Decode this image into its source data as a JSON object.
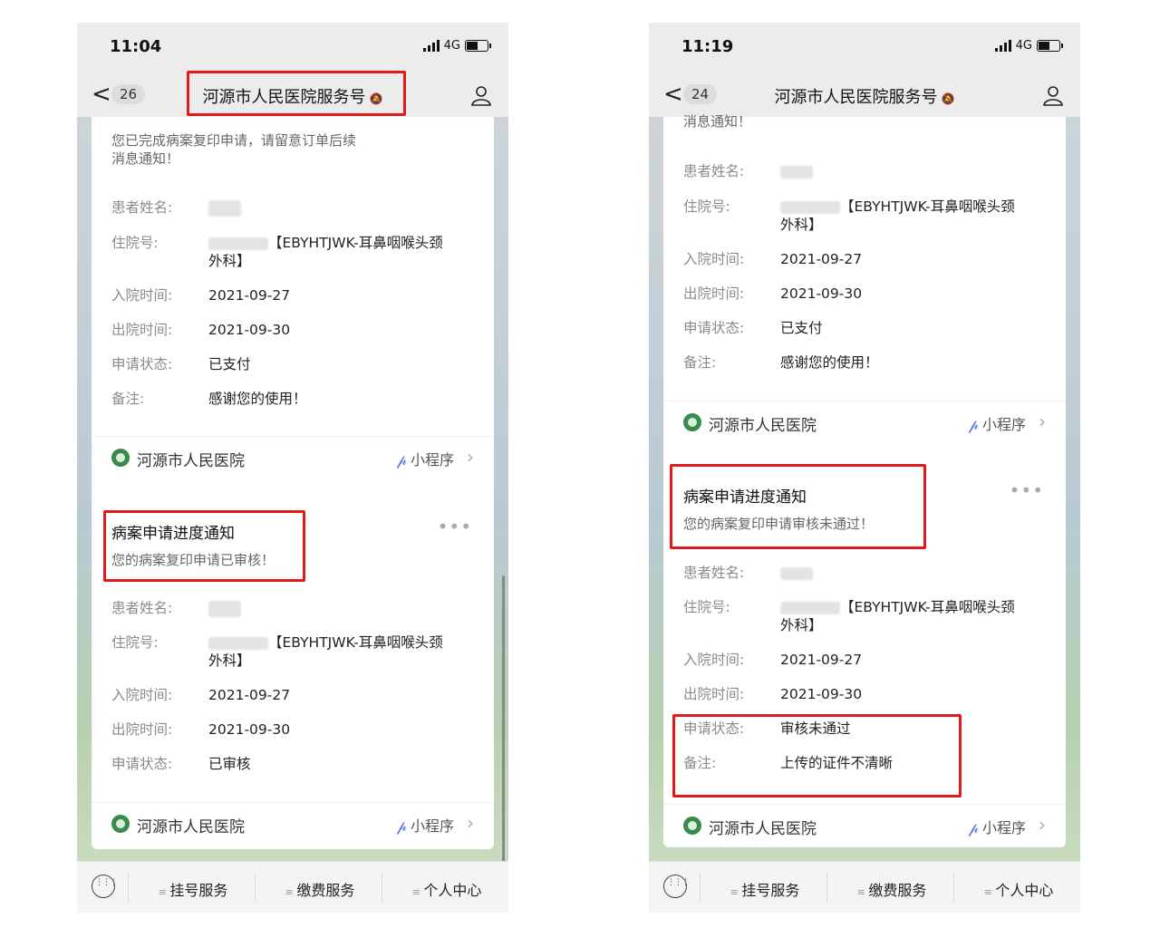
{
  "status": {
    "time_left": "11:04",
    "time_right": "11:19",
    "network": "4G"
  },
  "nav": {
    "title": "河源市人民医院服务号",
    "badge_left": "26",
    "badge_right": "24",
    "back": "<"
  },
  "labels": {
    "patient": "患者姓名:",
    "admission_no": "住院号:",
    "admit_time": "入院时间:",
    "discharge_time": "出院时间:",
    "status": "申请状态:",
    "remark": "备注:"
  },
  "common": {
    "dept": "【EBYHTJWK-耳鼻咽喉头颈外科】",
    "dept_line1": "【EBYHTJWK-耳鼻咽喉头颈",
    "dept_line2": "外科】",
    "admit_date": "2021-09-27",
    "discharge_date": "2021-09-30",
    "hospital": "河源市人民医院",
    "mini_program": "小程序"
  },
  "left": {
    "card1": {
      "desc_line1": "您已完成病案复印申请，请留意订单后续",
      "desc_line2": "消息通知！",
      "status": "已支付",
      "remark": "感谢您的使用！"
    },
    "card2": {
      "title": "病案申请进度通知",
      "desc": "您的病案复印申请已审核！",
      "status": "已审核"
    }
  },
  "right": {
    "card1": {
      "desc_partial": "消息通知！",
      "status": "已支付",
      "remark": "感谢您的使用！"
    },
    "card2": {
      "title": "病案申请进度通知",
      "desc": "您的病案复印申请审核未通过！",
      "status": "审核未通过",
      "remark": "上传的证件不清晰"
    }
  },
  "menu": {
    "item1": "挂号服务",
    "item2": "缴费服务",
    "item3": "个人中心"
  },
  "colors": {
    "highlight": "#e0191b",
    "card": "#ffffff",
    "nav": "#ececec"
  }
}
